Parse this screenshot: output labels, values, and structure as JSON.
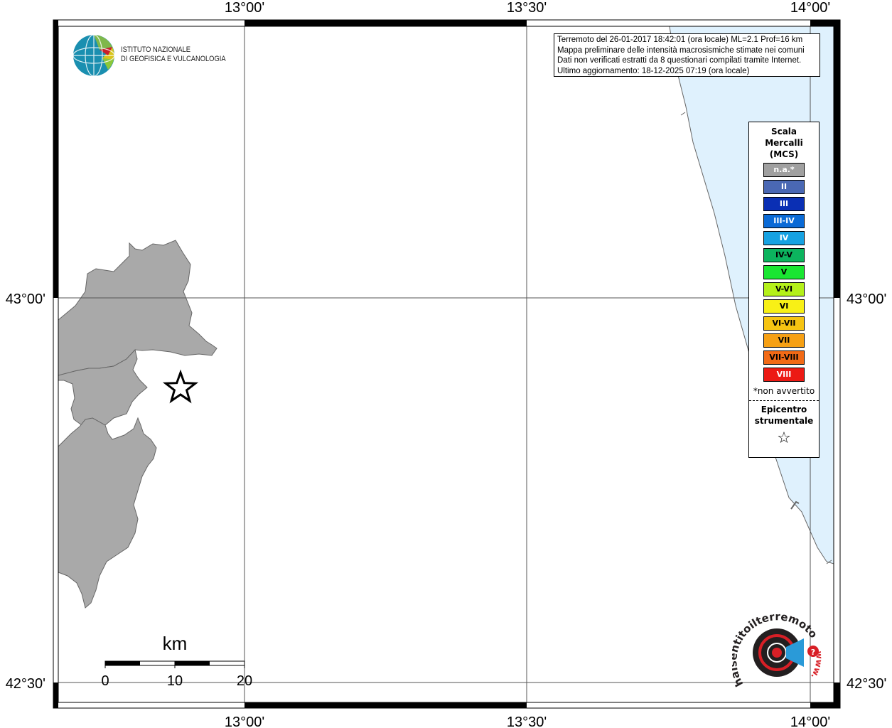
{
  "map": {
    "top_labels": [
      "13°00'",
      "13°30'",
      "14°00'"
    ],
    "bottom_labels": [
      "13°00'",
      "13°30'",
      "14°00'"
    ],
    "left_labels": [
      "43°00'",
      "42°30'"
    ],
    "right_labels": [
      "43°00'",
      "42°30'"
    ],
    "land_color": "#a9a9a9",
    "sea_color": "#dff1fd"
  },
  "info": {
    "line1": "Terremoto del 26-01-2017 18:42:01 (ora locale) ML=2.1 Prof=16 km",
    "line2": "Mappa preliminare delle intensità macrosismiche stimate nei comuni",
    "line3": "Dati non verificati estratti da 8 questionari compilati tramite Internet.",
    "line4": "Ultimo aggiornamento: 18-12-2025 07:19 (ora locale)"
  },
  "legend": {
    "title_lines": [
      "Scala",
      "Mercalli",
      "(MCS)"
    ],
    "items": [
      {
        "label": "n.a.*",
        "color": "#a0a0a0",
        "text_color": "#ffffff"
      },
      {
        "label": "II",
        "color": "#4a68b4",
        "text_color": "#ffffff"
      },
      {
        "label": "III",
        "color": "#0a2fb4",
        "text_color": "#ffffff"
      },
      {
        "label": "III-IV",
        "color": "#0a6ad6",
        "text_color": "#ffffff"
      },
      {
        "label": "IV",
        "color": "#16a2e2",
        "text_color": "#ffffff"
      },
      {
        "label": "IV-V",
        "color": "#0cb45e",
        "text_color": "#000000"
      },
      {
        "label": "V",
        "color": "#1ae632",
        "text_color": "#000000"
      },
      {
        "label": "V-VI",
        "color": "#b4f01a",
        "text_color": "#000000"
      },
      {
        "label": "VI",
        "color": "#f8f016",
        "text_color": "#000000"
      },
      {
        "label": "VI-VII",
        "color": "#f6c412",
        "text_color": "#000000"
      },
      {
        "label": "VII",
        "color": "#f6a014",
        "text_color": "#000000"
      },
      {
        "label": "VII-VIII",
        "color": "#f26a16",
        "text_color": "#000000"
      },
      {
        "label": "VIII",
        "color": "#ec1a14",
        "text_color": "#ffffff"
      }
    ],
    "note": "*non avvertito",
    "epicenter_lines": [
      "Epicentro",
      "strumentale"
    ],
    "epicenter_symbol": "☆"
  },
  "scalebar": {
    "unit": "km",
    "ticks": [
      "0",
      "10",
      "20"
    ]
  },
  "logos": {
    "ingv_line1": "ISTITUTO NAZIONALE",
    "ingv_line2": "DI GEOFISICA E VULCANOLOGIA",
    "hst_text": "haisentitoilterremoto.it",
    "hst_www": "www."
  }
}
